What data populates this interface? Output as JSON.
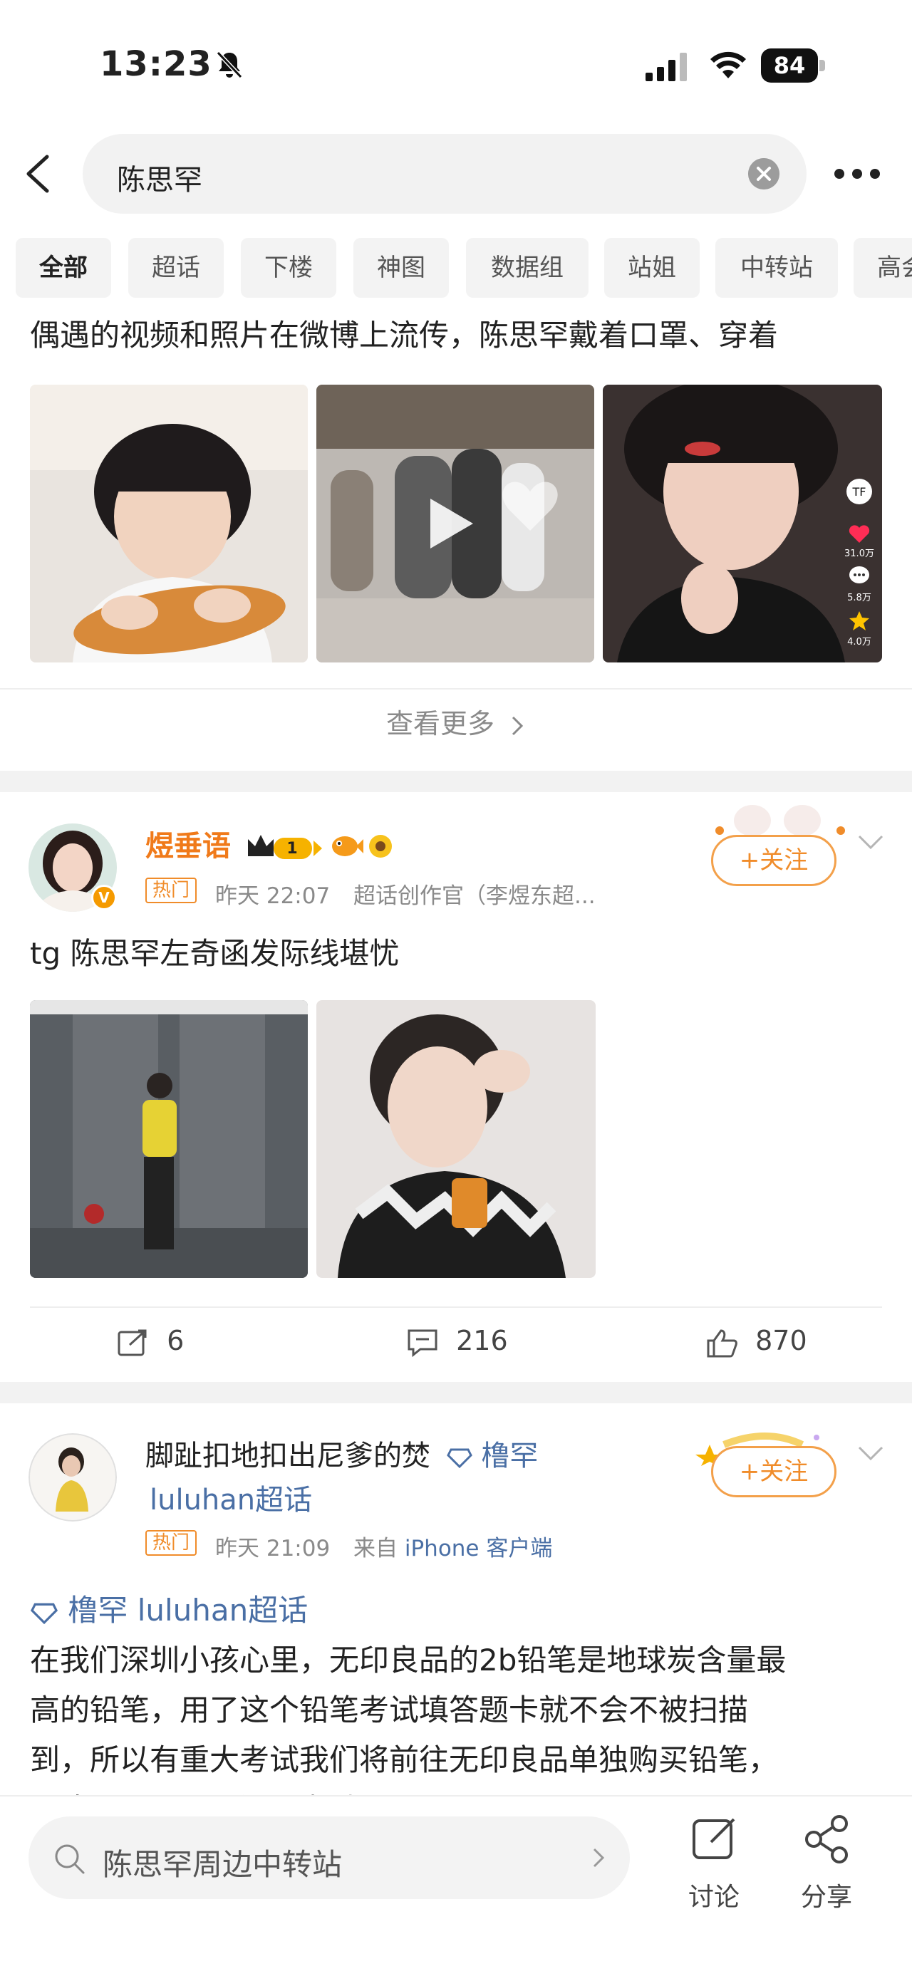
{
  "status_bar": {
    "time": "13:23",
    "battery": "84"
  },
  "search": {
    "query": "陈思罕"
  },
  "filter_tabs": [
    "全部",
    "超话",
    "下楼",
    "神图",
    "数据组",
    "站姐",
    "中转站",
    "高会"
  ],
  "post_top": {
    "text_line": "偶遇的视频和照片在微博上流传，陈思罕戴着口罩、穿着",
    "see_more": "查看更多",
    "image_overlay_counts": [
      "31.0万",
      "5.8万",
      "4.0万"
    ]
  },
  "post1": {
    "username": "煜垂语",
    "level": "1",
    "hot_tag": "热门",
    "time": "昨天 22:07",
    "source": "超话创作官（李煜东超...",
    "follow_label": "+关注",
    "content": "tg 陈思罕左奇函发际线堪忧",
    "reposts": "6",
    "comments": "216",
    "likes": "870"
  },
  "post2": {
    "username": "脚趾扣地扣出尼爹的焚",
    "supertopic_inline": "橹罕",
    "supertopic_line2": "luluhan超话",
    "hot_tag": "热门",
    "time": "昨天 21:09",
    "source_prefix": "来自",
    "source_device": "iPhone 客户端",
    "follow_label": "+关注",
    "topic_link": "橹罕 luluhan超话",
    "body_lines": [
      "在我们深圳小孩心里，无印良品的2b铅笔是地球炭含量最",
      "高的铅笔，用了这个铅笔考试填答题卡就不会不被扫描",
      "到，所以有重大考试我们将前往无印良品单独购买铅笔，",
      "而陈思罕明天飞深圳考试"
    ]
  },
  "bottom_bar": {
    "search_placeholder": "陈思罕周边中转站",
    "discuss_label": "讨论",
    "share_label": "分享"
  },
  "colors": {
    "accent_orange": "#f08c2a",
    "link_blue": "#4a6fa5",
    "username_orange": "#f07a1a"
  }
}
